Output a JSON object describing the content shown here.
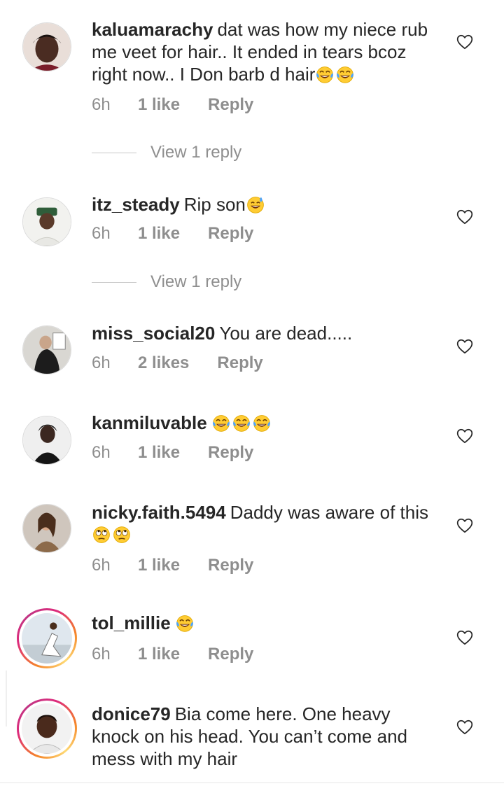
{
  "comments": [
    {
      "username": "kaluamarachy",
      "text": "dat was how my niece rub me veet for hair.. It ended in tears bcoz right now.. I Don barb d hair",
      "time": "6h",
      "likes": "1 like",
      "reply": "Reply",
      "view_replies": "View 1 reply"
    },
    {
      "username": "itz_steady",
      "text": "Rip son",
      "time": "6h",
      "likes": "1 like",
      "reply": "Reply",
      "view_replies": "View 1 reply"
    },
    {
      "username": "miss_social20",
      "text": "You are dead.....",
      "time": "6h",
      "likes": "2 likes",
      "reply": "Reply"
    },
    {
      "username": "kanmiluvable",
      "text": "",
      "time": "6h",
      "likes": "1 like",
      "reply": "Reply"
    },
    {
      "username": "nicky.faith.5494",
      "text": "Daddy was aware of this",
      "time": "6h",
      "likes": "1 like",
      "reply": "Reply"
    },
    {
      "username": "tol_millie",
      "text": "",
      "time": "6h",
      "likes": "1 like",
      "reply": "Reply"
    },
    {
      "username": "donice79",
      "text": "Bia come here. One heavy knock on his head.  You can’t come and mess with my hair"
    }
  ],
  "icons": {
    "like": "heart-outline-icon",
    "laughing": "face-with-tears-of-joy-emoji",
    "sweat_smile": "grinning-face-with-sweat-emoji",
    "eye_roll": "face-with-rolling-eyes-emoji"
  },
  "colors": {
    "text": "#262626",
    "secondary": "#8e8e8e",
    "story_ring": "#dd2a7b"
  }
}
